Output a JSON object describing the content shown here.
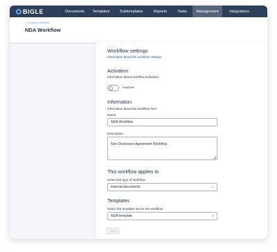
{
  "app": {
    "logo_text": "BIGLE"
  },
  "nav": {
    "items": [
      {
        "label": "Documents"
      },
      {
        "label": "Templates"
      },
      {
        "label": "Subtemplates"
      },
      {
        "label": "Reports"
      },
      {
        "label": "Tasks"
      },
      {
        "label": "Management",
        "active": true
      },
      {
        "label": "Integrations"
      }
    ]
  },
  "header": {
    "back_link": "< Go back to Workflow",
    "title": "NDA Workflow"
  },
  "settings": {
    "title": "Workflow settings",
    "subtitle": "Information about the workflow settings"
  },
  "activation": {
    "title": "Activation",
    "subtitle": "Information about workflow activation",
    "state_label": "Inactive",
    "enabled": false
  },
  "information": {
    "title": "Information",
    "subtitle": "Information about the workflow form",
    "name_label": "Name",
    "name_value": "NDA Workflow",
    "description_label": "Description",
    "description_value": "Non Disclosure Agreement Workflow"
  },
  "applies_to": {
    "title": "This workflow applies to",
    "select_label": "Select the type of workflow",
    "selected": "Internal documents"
  },
  "templates": {
    "title": "Templates",
    "select_label": "Select the template set for the workflow",
    "selected": "NDA template"
  },
  "actions": {
    "save_label": "Save"
  },
  "colors": {
    "nav_bg": "#2c3e5a",
    "nav_active": "#55657c",
    "accent_link": "#5b8fd6",
    "subtitle_blue": "#1f4a8a"
  }
}
